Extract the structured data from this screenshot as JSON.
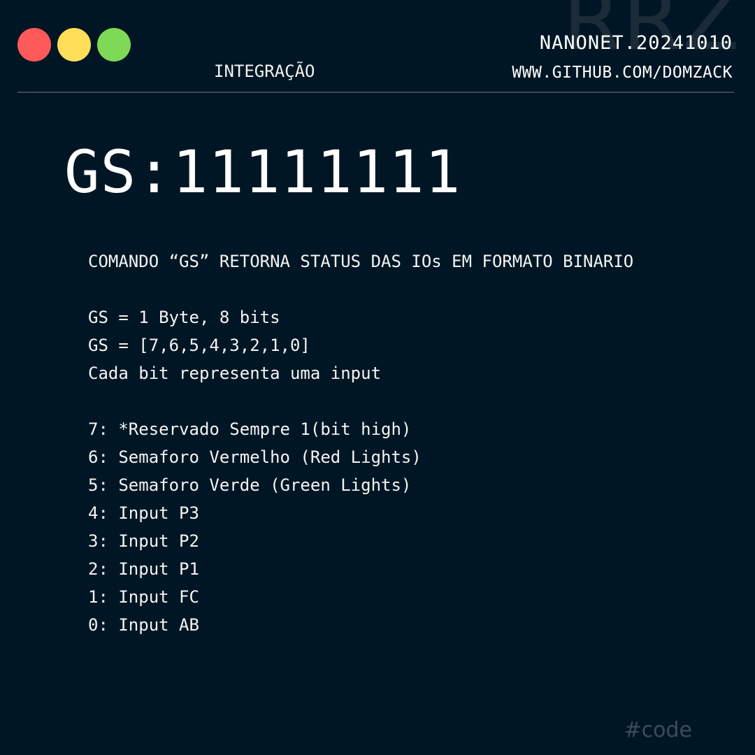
{
  "watermark": "RRZ",
  "header": {
    "category": "INTEGRAÇÃO",
    "build_id": "NANONET.20241010",
    "repo": "WWW.GITHUB.COM/DOMZACK"
  },
  "title": "GS:11111111",
  "intro": "COMANDO “GS” RETORNA STATUS DAS IOs EM FORMATO BINARIO",
  "format_lines": [
    "GS = 1 Byte, 8 bits",
    "GS = [7,6,5,4,3,2,1,0]",
    "Cada bit representa uma input"
  ],
  "bits": [
    "7: *Reservado Sempre 1(bit high)",
    "6: Semaforo Vermelho (Red Lights)",
    "5: Semaforo Verde (Green Lights)",
    "4: Input P3",
    "3: Input P2",
    "2: Input P1",
    "1: Input FC",
    "0: Input AB"
  ],
  "tag": "#code",
  "colors": {
    "background": "#011624",
    "dot_red": "#ff5a5a",
    "dot_yellow": "#ffde59",
    "dot_green": "#7ed957"
  }
}
